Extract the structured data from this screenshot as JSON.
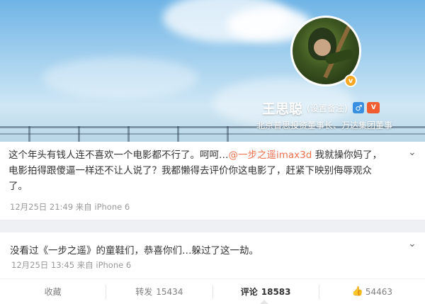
{
  "profile": {
    "name": "王思聪",
    "remark": "(设置备注)",
    "gender_icon": "♂",
    "vip_icon": "V",
    "verified_icon": "v",
    "bio": "北京普思投资董事长、万达集团董事"
  },
  "post": {
    "line1_before": "这个年头有钱人连不喜欢一个电影都不行了。呵呵…",
    "mention": "@一步之遥imax3d",
    "line1_after": " 我就操你妈了，",
    "line2": "电影拍得跟傻逼一样还不让人说了？我都懒得去评价你这电影了，赶紧下映别侮辱观众",
    "line3": "了。",
    "meta": "12月25日 21:49 来自 iPhone 6"
  },
  "repost": {
    "text": "没看过《一步之遥》的童鞋们，恭喜你们…躲过了这一劫。",
    "meta": "12月25日 13:45 来自 iPhone 6"
  },
  "actions": {
    "favorite": "收藏",
    "repost_label": "转发",
    "repost_count": "15434",
    "comment_label": "评论",
    "comment_count": "18583",
    "like_icon": "👍",
    "like_count": "54463"
  },
  "chevron": "⌄"
}
